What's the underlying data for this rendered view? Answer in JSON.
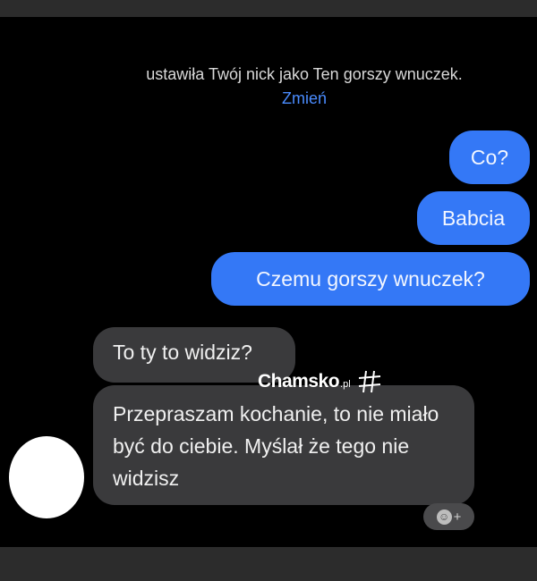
{
  "notice": {
    "text": "ustawiła Twój nick jako Ten gorszy wnuczek.",
    "link": "Zmień"
  },
  "messages": {
    "outgoing": [
      "Co?",
      "Babcia",
      "Czemu gorszy wnuczek?"
    ],
    "incoming": [
      "To ty to widziz?",
      "Przepraszam kochanie, to nie miało być do ciebie. Myślał że tego nie widzisz"
    ]
  },
  "reaction": {
    "icon": "smiley-icon",
    "plus": "+"
  },
  "watermark": {
    "main": "Chamsko",
    "sub": ".pl",
    "icon": "hashtag-icon"
  },
  "colors": {
    "outgoing_bubble": "#3478f6",
    "incoming_bubble": "#3a3a3c",
    "link": "#4a8cff",
    "background": "#000000"
  }
}
